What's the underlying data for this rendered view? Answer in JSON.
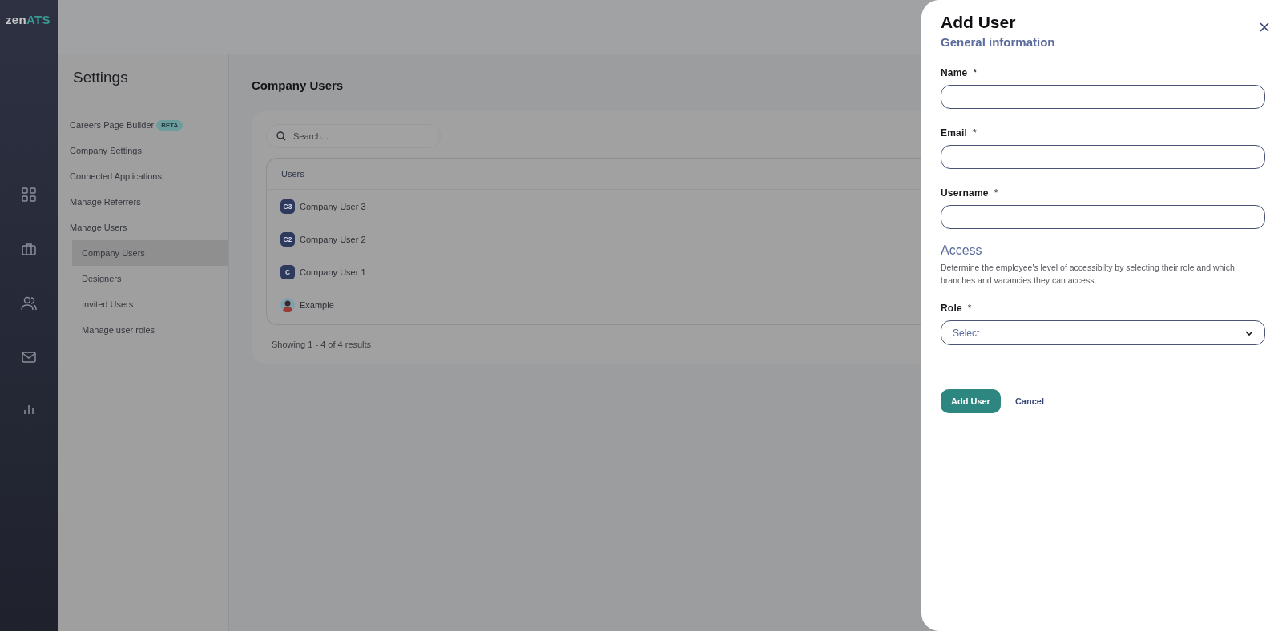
{
  "brand": {
    "part_1": "zen",
    "part_2": "ATS"
  },
  "nav": [
    {
      "kind": "grid",
      "selected": false
    },
    {
      "kind": "briefcase",
      "selected": false
    },
    {
      "kind": "people",
      "selected": false
    },
    {
      "kind": "mail",
      "selected": false
    },
    {
      "kind": "chart",
      "selected": false
    }
  ],
  "settings": {
    "title": "Settings",
    "items": [
      {
        "label": "Careers Page Builder",
        "badge": "BETA",
        "selected": false
      },
      {
        "label": "Company Settings",
        "selected": false
      },
      {
        "label": "Connected Applications",
        "selected": false
      },
      {
        "label": "Manage Referrers",
        "selected": false
      },
      {
        "label": "Manage Users",
        "selected": false,
        "children": [
          {
            "label": "Company Users",
            "selected": true
          },
          {
            "label": "Designers",
            "selected": false
          },
          {
            "label": "Invited Users",
            "selected": false
          },
          {
            "label": "Manage user roles",
            "selected": false
          }
        ]
      }
    ]
  },
  "page": {
    "title": "Company Users",
    "search": {
      "placeholder": "Search..."
    },
    "table": {
      "columns": [
        "Users"
      ],
      "rows": [
        {
          "kind": "initials",
          "initials": "C3",
          "name": "Company User 3"
        },
        {
          "kind": "initials",
          "initials": "C2",
          "name": "Company User 2"
        },
        {
          "kind": "initials",
          "initials": "C",
          "name": "Company User 1"
        },
        {
          "kind": "photo",
          "name": "Example"
        }
      ]
    },
    "footer": "Showing 1 - 4 of 4 results"
  },
  "drawer": {
    "title": "Add User",
    "section_1": "General information",
    "fields": [
      {
        "kind": "text",
        "label": "Name",
        "required_mark": "*"
      },
      {
        "kind": "text",
        "label": "Email",
        "required_mark": "*"
      },
      {
        "kind": "text",
        "label": "Username",
        "required_mark": "*"
      }
    ],
    "section_2": "Access",
    "description": "Determine the employee's level of accessibilty by selecting their role and which branches and vacancies they can access.",
    "role": {
      "label": "Role",
      "required_mark": "*",
      "placeholder": "Select"
    },
    "buttons": {
      "primary": "Add User",
      "secondary": "Cancel"
    }
  }
}
